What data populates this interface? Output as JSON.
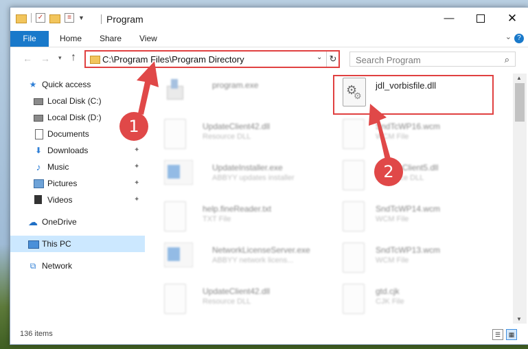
{
  "window": {
    "title": "Program",
    "min_glyph": "—",
    "close_glyph": "✕"
  },
  "ribbon": {
    "tabs": [
      "File",
      "Home",
      "Share",
      "View"
    ],
    "expand_glyph": "⌄",
    "help_glyph": "?"
  },
  "nav": {
    "back_glyph": "←",
    "forward_glyph": "→",
    "recent_glyph": "▾",
    "up_glyph": "↑"
  },
  "address": {
    "path": "C:\\Program Files\\Program Directory",
    "drop_glyph": "⌄",
    "refresh_glyph": "↻"
  },
  "search": {
    "placeholder": "Search Program",
    "icon_glyph": "⌕"
  },
  "sidebar": {
    "items": [
      {
        "label": "Quick access",
        "icon": "star-icon",
        "glyph": "★",
        "color": "#2f7fd6"
      },
      {
        "label": "Local Disk (C:)",
        "icon": "drive-icon"
      },
      {
        "label": "Local Disk (D:)",
        "icon": "drive-icon"
      },
      {
        "label": "Documents",
        "icon": "document-icon"
      },
      {
        "label": "Downloads",
        "icon": "download-arrow-icon",
        "glyph": "⬇",
        "color": "#2f7fd6"
      },
      {
        "label": "Music",
        "icon": "music-note-icon",
        "glyph": "♪",
        "color": "#2f7fd6"
      },
      {
        "label": "Pictures",
        "icon": "pictures-icon"
      },
      {
        "label": "Videos",
        "icon": "videos-icon"
      },
      {
        "label": "OneDrive",
        "icon": "cloud-icon",
        "glyph": "☁",
        "color": "#1f6fc5"
      },
      {
        "label": "This PC",
        "icon": "computer-icon",
        "selected": true
      },
      {
        "label": "Network",
        "icon": "network-icon",
        "glyph": "⧉",
        "color": "#2f7fd6"
      }
    ],
    "pin_glyph": "📌"
  },
  "files": {
    "left": [
      {
        "name": "program.exe",
        "type": "",
        "icon": "exe-icon"
      },
      {
        "name": "UpdateClient42.dll",
        "type": "Resource DLL",
        "icon": "page-icon"
      },
      {
        "name": "UpdateInstaller.exe",
        "type": "ABBYY updates installer",
        "icon": "app-icon"
      },
      {
        "name": "help.fineReader.txt",
        "type": "TXT File",
        "icon": "page-icon"
      },
      {
        "name": "NetworkLicenseServer.exe",
        "type": "ABBYY network licens...",
        "icon": "app-icon"
      },
      {
        "name": "UpdateClient42.dll",
        "type": "Resource DLL",
        "icon": "page-icon"
      }
    ],
    "right": [
      {
        "name": "jdl_vorbisfile.dll",
        "type": "",
        "icon": "dll-icon"
      },
      {
        "name": "SndTcWP16.wcm",
        "type": "WCM File",
        "icon": "page-icon"
      },
      {
        "name": "UpdateClient5.dll",
        "type": "Resource DLL",
        "icon": "page-icon"
      },
      {
        "name": "SndTcWP14.wcm",
        "type": "WCM File",
        "icon": "page-icon"
      },
      {
        "name": "SndTcWP13.wcm",
        "type": "WCM File",
        "icon": "page-icon"
      },
      {
        "name": "gtd.cjk",
        "type": "CJK File",
        "icon": "page-icon"
      }
    ]
  },
  "annotations": {
    "step1": "1",
    "step2": "2",
    "color": "#e04040"
  },
  "status": {
    "item_count": "136 items",
    "details_glyph": "☰",
    "icons_glyph": "▦"
  },
  "colors": {
    "accent": "#1979ca",
    "selection": "#cce8ff"
  }
}
